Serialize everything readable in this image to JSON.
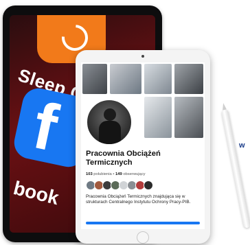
{
  "back_tablet": {
    "apps": {
      "sleep_label": "Sleep C",
      "book_label": "book",
      "facebook_glyph": "f"
    },
    "colors": {
      "orange_app": "#f27a1a",
      "facebook_blue": "#1877f2",
      "wallpaper": "#6b1013"
    }
  },
  "profile": {
    "name": "Pracownia Obciążeń Termicznych",
    "stats": {
      "likes_count": "103",
      "likes_label": "polubienia",
      "separator": "•",
      "followers_count": "149",
      "followers_label": "obserwujący"
    },
    "description": "Pracownia Obciążeń Termicznych znajdująca się w strukturach Centralnego Instytutu Ochrony Pracy-PIB.",
    "friend_avatars": [
      "avatar-1",
      "avatar-2",
      "avatar-3",
      "avatar-4",
      "avatar-5",
      "avatar-6",
      "avatar-7",
      "avatar-8"
    ],
    "accent_color": "#1877f2"
  },
  "side_text": "w"
}
